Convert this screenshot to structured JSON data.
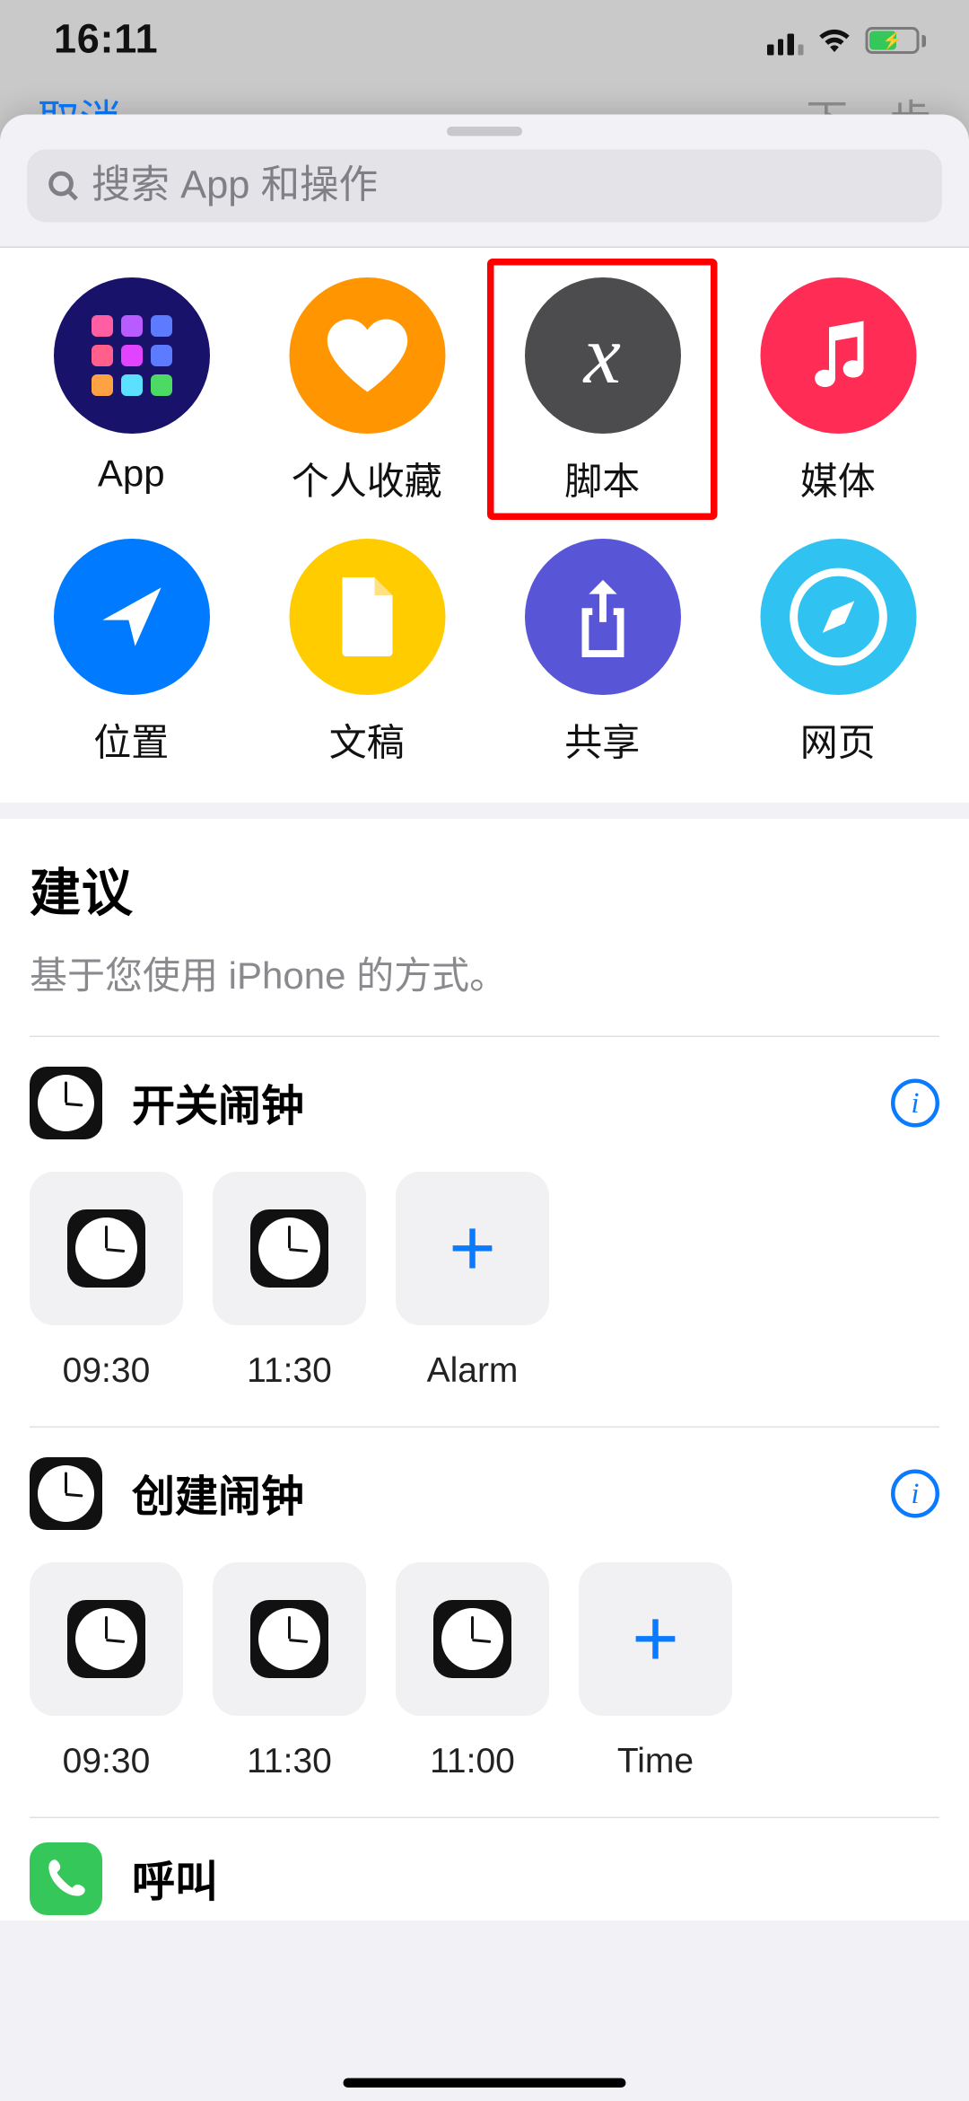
{
  "status_bar": {
    "time": "16:11"
  },
  "background_nav": {
    "cancel": "取消",
    "next": "下一步"
  },
  "search": {
    "placeholder": "搜索 App 和操作"
  },
  "categories": [
    {
      "id": "app",
      "label": "App"
    },
    {
      "id": "fav",
      "label": "个人收藏"
    },
    {
      "id": "script",
      "label": "脚本"
    },
    {
      "id": "media",
      "label": "媒体"
    },
    {
      "id": "loc",
      "label": "位置"
    },
    {
      "id": "doc",
      "label": "文稿"
    },
    {
      "id": "share",
      "label": "共享"
    },
    {
      "id": "web",
      "label": "网页"
    }
  ],
  "suggestions_header": {
    "title": "建议",
    "subtitle": "基于您使用 iPhone 的方式。"
  },
  "groups": [
    {
      "title": "开关闹钟",
      "tiles": [
        {
          "label": "09:30",
          "kind": "clock"
        },
        {
          "label": "11:30",
          "kind": "clock"
        },
        {
          "label": "Alarm",
          "kind": "add"
        }
      ]
    },
    {
      "title": "创建闹钟",
      "tiles": [
        {
          "label": "09:30",
          "kind": "clock"
        },
        {
          "label": "11:30",
          "kind": "clock"
        },
        {
          "label": "11:00",
          "kind": "clock"
        },
        {
          "label": "Time",
          "kind": "add"
        }
      ]
    }
  ],
  "extra_row": {
    "title": "呼叫"
  }
}
